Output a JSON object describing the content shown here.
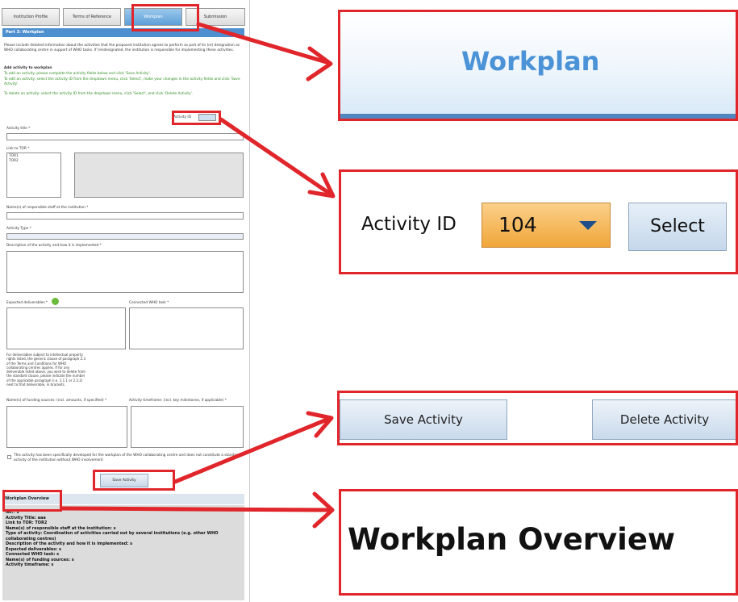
{
  "tabs": [
    {
      "label": "Institution Profile",
      "active": false
    },
    {
      "label": "Terms of Reference",
      "active": false
    },
    {
      "label": "Workplan",
      "active": true
    },
    {
      "label": "Submission",
      "active": false
    }
  ],
  "section_title": "Part 3: Workplan",
  "intro_text": "Please include detailed information about the activities that the proposed institution agrees to perform as part of its (re) designation as WHO collaborating centre in support of WHO tasks. If (re)designated, the institution is responsible for implementing these activities.",
  "add_heading": "Add activity to workplan",
  "instructions": [
    "To add an activity:    please complete the activity fields below and click 'Save Activity'.",
    "To edit an activity:    select the activity ID from the dropdown menu, click 'Select', make your changes in the activity fields and click 'Save Activity'.",
    "To delete an activity:    select the activity ID from the dropdown menu, click 'Select', and click 'Delete Activity'."
  ],
  "activity_id_small_label": "Activity ID",
  "fields": {
    "activity_title": "Activity title *",
    "link_to_tor": "Link to TOR *",
    "tor_options": [
      "TOR1",
      "TOR2"
    ],
    "responsible_staff": "Name(s) of responsible staff at the institution *",
    "activity_type": "Activity Type *",
    "description": "Description of the activity and how it is implemented *",
    "expected_deliverables": "Expected deliverables *",
    "connected_task": "Connected WHO task *",
    "ip_note": "For deliverables subject to intellectual property rights listed, the generic clause of paragraph 2.3 of the Terms and Conditions for WHO collaborating centres applies. If for any deliverable listed above, you wish to delete from the standard clause, please indicate the number of the applicable paragraph (i.e. 2.1.1 or 2.3.2) next to that deliverable, in brackets.",
    "funding_sources": "Name(s) of funding sources: (incl. amounts, if specified) *",
    "timeframe": "Activity timeframe: (incl. key milestones, if applicable) *",
    "checkbox_text": "This activity has been specifically developed for the workplan of the WHO collaborating centre and does not constitute a standard activity of the institution without WHO involvement"
  },
  "small_save_button": "Save Activity",
  "overview": {
    "title": "Workplan Overview",
    "lines": [
      "No.: 1",
      "Activity Title: aaa",
      "Link to TOR: TOR2",
      "Name(s) of responsible staff at the institution: s",
      "Type of activity: Coordination of activities carried out by several institutions (e.g. other WHO",
      "collaborating centres)",
      "Description of the activity and how it is implemented: s",
      "Expected deliverables: s",
      "Connected WHO task: s",
      "Name(s) of funding sources: s",
      "Activity timeframe: s"
    ]
  },
  "zoom": {
    "workplan_title": "Workplan",
    "activity_id_label": "Activity ID",
    "activity_id_value": "104",
    "select_button": "Select",
    "save_button": "Save Activity",
    "delete_button": "Delete Activity",
    "overview_title": "Workplan Overview"
  },
  "colors": {
    "highlight_red": "#e0262b",
    "accent_blue": "#4b93d6",
    "dropdown_orange": "#f1a63a"
  }
}
